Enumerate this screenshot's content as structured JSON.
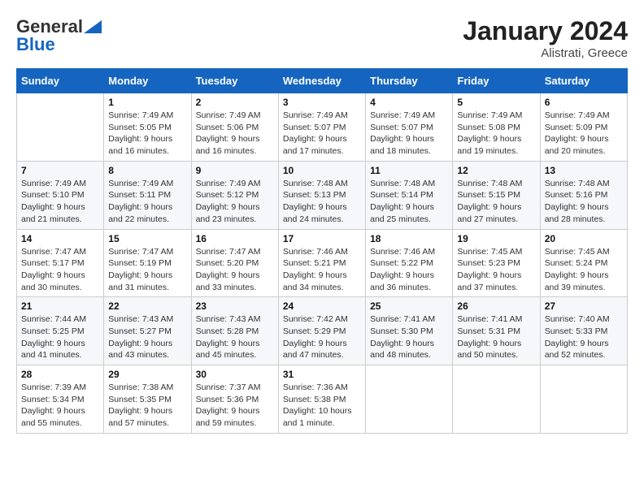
{
  "header": {
    "logo_general": "General",
    "logo_blue": "Blue",
    "month_title": "January 2024",
    "location": "Alistrati, Greece"
  },
  "weekdays": [
    "Sunday",
    "Monday",
    "Tuesday",
    "Wednesday",
    "Thursday",
    "Friday",
    "Saturday"
  ],
  "weeks": [
    [
      {
        "day": "",
        "sunrise": "",
        "sunset": "",
        "daylight": ""
      },
      {
        "day": "1",
        "sunrise": "Sunrise: 7:49 AM",
        "sunset": "Sunset: 5:05 PM",
        "daylight": "Daylight: 9 hours and 16 minutes."
      },
      {
        "day": "2",
        "sunrise": "Sunrise: 7:49 AM",
        "sunset": "Sunset: 5:06 PM",
        "daylight": "Daylight: 9 hours and 16 minutes."
      },
      {
        "day": "3",
        "sunrise": "Sunrise: 7:49 AM",
        "sunset": "Sunset: 5:07 PM",
        "daylight": "Daylight: 9 hours and 17 minutes."
      },
      {
        "day": "4",
        "sunrise": "Sunrise: 7:49 AM",
        "sunset": "Sunset: 5:07 PM",
        "daylight": "Daylight: 9 hours and 18 minutes."
      },
      {
        "day": "5",
        "sunrise": "Sunrise: 7:49 AM",
        "sunset": "Sunset: 5:08 PM",
        "daylight": "Daylight: 9 hours and 19 minutes."
      },
      {
        "day": "6",
        "sunrise": "Sunrise: 7:49 AM",
        "sunset": "Sunset: 5:09 PM",
        "daylight": "Daylight: 9 hours and 20 minutes."
      }
    ],
    [
      {
        "day": "7",
        "sunrise": "Sunrise: 7:49 AM",
        "sunset": "Sunset: 5:10 PM",
        "daylight": "Daylight: 9 hours and 21 minutes."
      },
      {
        "day": "8",
        "sunrise": "Sunrise: 7:49 AM",
        "sunset": "Sunset: 5:11 PM",
        "daylight": "Daylight: 9 hours and 22 minutes."
      },
      {
        "day": "9",
        "sunrise": "Sunrise: 7:49 AM",
        "sunset": "Sunset: 5:12 PM",
        "daylight": "Daylight: 9 hours and 23 minutes."
      },
      {
        "day": "10",
        "sunrise": "Sunrise: 7:48 AM",
        "sunset": "Sunset: 5:13 PM",
        "daylight": "Daylight: 9 hours and 24 minutes."
      },
      {
        "day": "11",
        "sunrise": "Sunrise: 7:48 AM",
        "sunset": "Sunset: 5:14 PM",
        "daylight": "Daylight: 9 hours and 25 minutes."
      },
      {
        "day": "12",
        "sunrise": "Sunrise: 7:48 AM",
        "sunset": "Sunset: 5:15 PM",
        "daylight": "Daylight: 9 hours and 27 minutes."
      },
      {
        "day": "13",
        "sunrise": "Sunrise: 7:48 AM",
        "sunset": "Sunset: 5:16 PM",
        "daylight": "Daylight: 9 hours and 28 minutes."
      }
    ],
    [
      {
        "day": "14",
        "sunrise": "Sunrise: 7:47 AM",
        "sunset": "Sunset: 5:17 PM",
        "daylight": "Daylight: 9 hours and 30 minutes."
      },
      {
        "day": "15",
        "sunrise": "Sunrise: 7:47 AM",
        "sunset": "Sunset: 5:19 PM",
        "daylight": "Daylight: 9 hours and 31 minutes."
      },
      {
        "day": "16",
        "sunrise": "Sunrise: 7:47 AM",
        "sunset": "Sunset: 5:20 PM",
        "daylight": "Daylight: 9 hours and 33 minutes."
      },
      {
        "day": "17",
        "sunrise": "Sunrise: 7:46 AM",
        "sunset": "Sunset: 5:21 PM",
        "daylight": "Daylight: 9 hours and 34 minutes."
      },
      {
        "day": "18",
        "sunrise": "Sunrise: 7:46 AM",
        "sunset": "Sunset: 5:22 PM",
        "daylight": "Daylight: 9 hours and 36 minutes."
      },
      {
        "day": "19",
        "sunrise": "Sunrise: 7:45 AM",
        "sunset": "Sunset: 5:23 PM",
        "daylight": "Daylight: 9 hours and 37 minutes."
      },
      {
        "day": "20",
        "sunrise": "Sunrise: 7:45 AM",
        "sunset": "Sunset: 5:24 PM",
        "daylight": "Daylight: 9 hours and 39 minutes."
      }
    ],
    [
      {
        "day": "21",
        "sunrise": "Sunrise: 7:44 AM",
        "sunset": "Sunset: 5:25 PM",
        "daylight": "Daylight: 9 hours and 41 minutes."
      },
      {
        "day": "22",
        "sunrise": "Sunrise: 7:43 AM",
        "sunset": "Sunset: 5:27 PM",
        "daylight": "Daylight: 9 hours and 43 minutes."
      },
      {
        "day": "23",
        "sunrise": "Sunrise: 7:43 AM",
        "sunset": "Sunset: 5:28 PM",
        "daylight": "Daylight: 9 hours and 45 minutes."
      },
      {
        "day": "24",
        "sunrise": "Sunrise: 7:42 AM",
        "sunset": "Sunset: 5:29 PM",
        "daylight": "Daylight: 9 hours and 47 minutes."
      },
      {
        "day": "25",
        "sunrise": "Sunrise: 7:41 AM",
        "sunset": "Sunset: 5:30 PM",
        "daylight": "Daylight: 9 hours and 48 minutes."
      },
      {
        "day": "26",
        "sunrise": "Sunrise: 7:41 AM",
        "sunset": "Sunset: 5:31 PM",
        "daylight": "Daylight: 9 hours and 50 minutes."
      },
      {
        "day": "27",
        "sunrise": "Sunrise: 7:40 AM",
        "sunset": "Sunset: 5:33 PM",
        "daylight": "Daylight: 9 hours and 52 minutes."
      }
    ],
    [
      {
        "day": "28",
        "sunrise": "Sunrise: 7:39 AM",
        "sunset": "Sunset: 5:34 PM",
        "daylight": "Daylight: 9 hours and 55 minutes."
      },
      {
        "day": "29",
        "sunrise": "Sunrise: 7:38 AM",
        "sunset": "Sunset: 5:35 PM",
        "daylight": "Daylight: 9 hours and 57 minutes."
      },
      {
        "day": "30",
        "sunrise": "Sunrise: 7:37 AM",
        "sunset": "Sunset: 5:36 PM",
        "daylight": "Daylight: 9 hours and 59 minutes."
      },
      {
        "day": "31",
        "sunrise": "Sunrise: 7:36 AM",
        "sunset": "Sunset: 5:38 PM",
        "daylight": "Daylight: 10 hours and 1 minute."
      },
      {
        "day": "",
        "sunrise": "",
        "sunset": "",
        "daylight": ""
      },
      {
        "day": "",
        "sunrise": "",
        "sunset": "",
        "daylight": ""
      },
      {
        "day": "",
        "sunrise": "",
        "sunset": "",
        "daylight": ""
      }
    ]
  ]
}
